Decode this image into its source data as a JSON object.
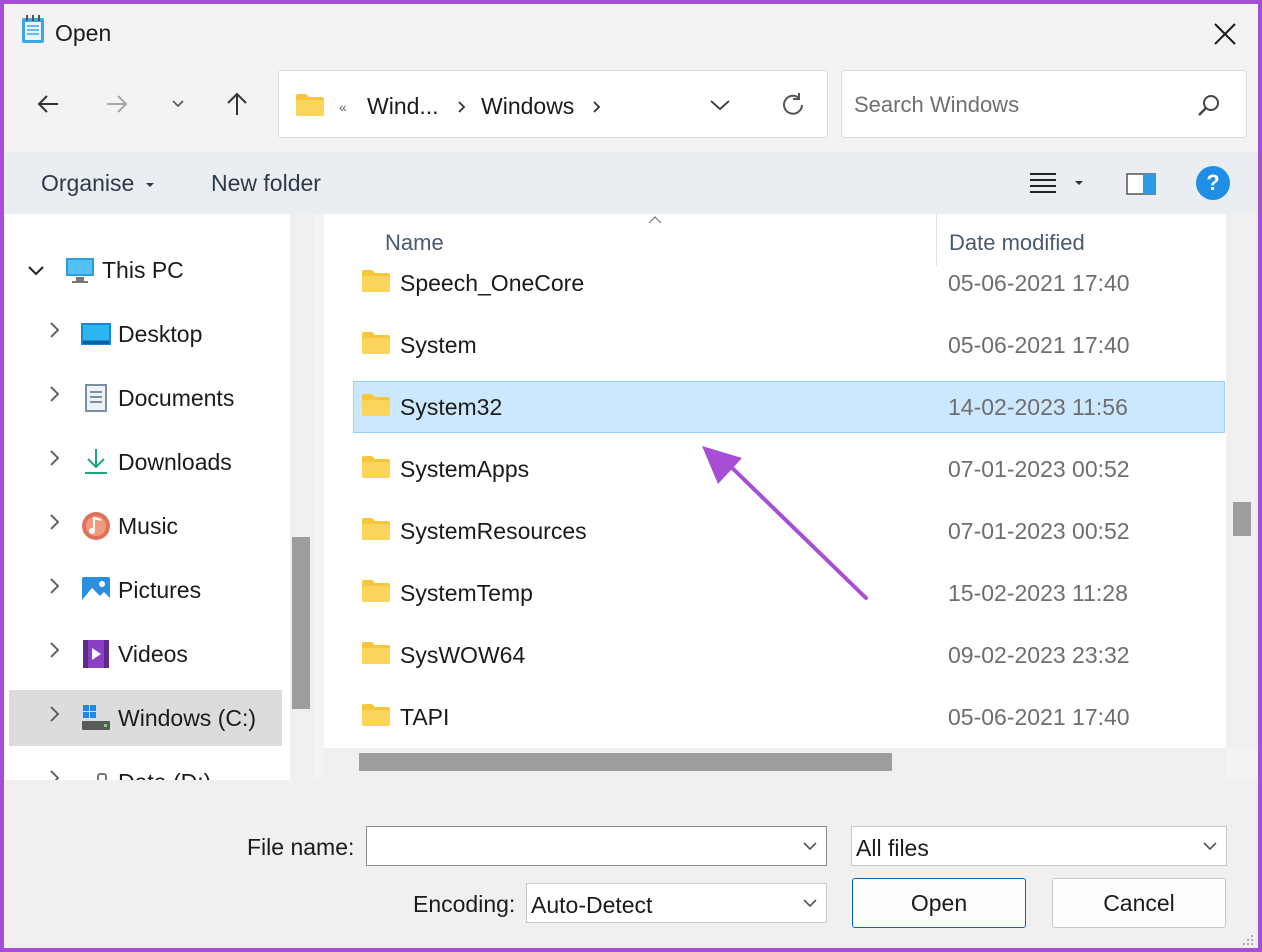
{
  "window": {
    "title": "Open"
  },
  "nav": {
    "address_segments": [
      "«",
      "Wind...",
      "Windows"
    ],
    "search_placeholder": "Search Windows"
  },
  "toolbar": {
    "organise": "Organise",
    "new_folder": "New folder"
  },
  "sidebar": {
    "items": [
      {
        "label": "This PC"
      },
      {
        "label": "Desktop"
      },
      {
        "label": "Documents"
      },
      {
        "label": "Downloads"
      },
      {
        "label": "Music"
      },
      {
        "label": "Pictures"
      },
      {
        "label": "Videos"
      },
      {
        "label": "Windows (C:)"
      },
      {
        "label": "Data (D:)"
      }
    ]
  },
  "list": {
    "columns": {
      "name": "Name",
      "date": "Date modified"
    },
    "rows": [
      {
        "name": "Speech_OneCore",
        "date": "05-06-2021 17:40"
      },
      {
        "name": "System",
        "date": "05-06-2021 17:40"
      },
      {
        "name": "System32",
        "date": "14-02-2023 11:56"
      },
      {
        "name": "SystemApps",
        "date": "07-01-2023 00:52"
      },
      {
        "name": "SystemResources",
        "date": "07-01-2023 00:52"
      },
      {
        "name": "SystemTemp",
        "date": "15-02-2023 11:28"
      },
      {
        "name": "SysWOW64",
        "date": "09-02-2023 23:32"
      },
      {
        "name": "TAPI",
        "date": "05-06-2021 17:40"
      }
    ]
  },
  "footer": {
    "file_name_label": "File name:",
    "file_name_value": "",
    "file_type": "All files",
    "encoding_label": "Encoding:",
    "encoding_value": "Auto-Detect",
    "open": "Open",
    "cancel": "Cancel"
  },
  "colors": {
    "selection": "#cce8ff",
    "accent": "#0067c0",
    "annotation_arrow": "#a64fd6",
    "folder": "#f8c63d"
  }
}
